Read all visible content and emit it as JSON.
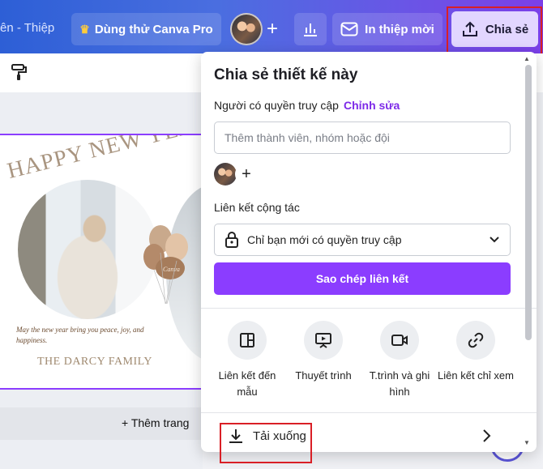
{
  "topbar": {
    "doc_title": "ên - Thiệp",
    "pro_label": "Dùng thử Canva Pro",
    "invite_label": "In thiệp mời",
    "share_label": "Chia sẻ"
  },
  "canvas": {
    "card_heading": "HAPPY NEW YEAR",
    "card_message": "May the new year bring you peace, joy, and happiness.",
    "card_family": "THE DARCY FAMILY",
    "balloon_text": "Canva",
    "add_page": "+ Thêm trang"
  },
  "share_panel": {
    "title": "Chia sẻ thiết kế này",
    "access_label": "Người có quyền truy cập",
    "access_edit": "Chỉnh sửa",
    "member_placeholder": "Thêm thành viên, nhóm hoặc đội",
    "collab_label": "Liên kết cộng tác",
    "link_option": "Chỉ bạn mới có quyền truy cập",
    "copy_button": "Sao chép liên kết",
    "options": [
      {
        "icon": "layout-icon",
        "label": "Liên kết đến mẫu"
      },
      {
        "icon": "present-icon",
        "label": "Thuyết trình"
      },
      {
        "icon": "video-icon",
        "label": "T.trình và ghi hình"
      },
      {
        "icon": "link-icon",
        "label": "Liên kết chỉ xem"
      }
    ],
    "download_label": "Tải xuống"
  },
  "colors": {
    "accent": "#8b3dff",
    "highlight": "#d91f26"
  }
}
